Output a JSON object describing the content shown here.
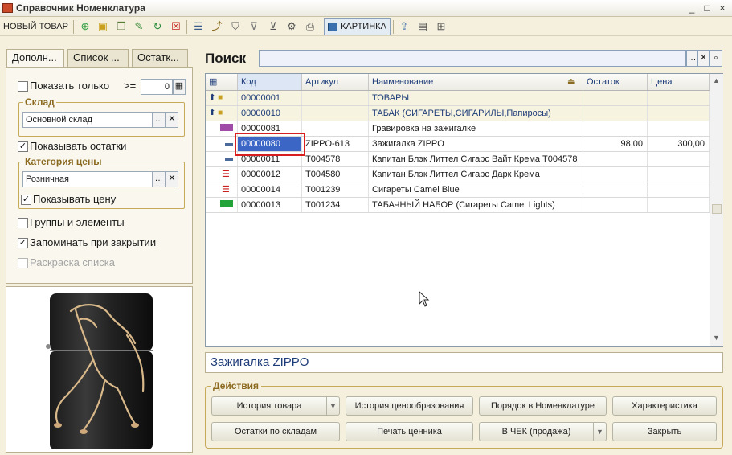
{
  "window": {
    "title": "Справочник Номенклатура",
    "controls": [
      "_",
      "□",
      "×"
    ]
  },
  "toolbar": {
    "new_item": "НОВЫЙ ТОВАР",
    "picture": "КАРТИНКА"
  },
  "left_tabs": [
    "Дополн...",
    "Список ...",
    "Остатк..."
  ],
  "filters": {
    "show_only_label": "Показать только",
    "show_only_op": ">=",
    "show_only_value": "0",
    "warehouse_title": "Склад",
    "warehouse_value": "Основной склад",
    "show_stock_label": "Показывать остатки",
    "price_category_title": "Категория цены",
    "price_category_value": "Розничная",
    "show_price_label": "Показывать цену",
    "groups_label": "Группы и элементы",
    "remember_label": "Запоминать при закрытии",
    "coloring_label": "Раскраска списка"
  },
  "search": {
    "label": "Поиск",
    "value": ""
  },
  "table": {
    "columns": [
      "Код",
      "Артикул",
      "Наименование",
      "Остаток",
      "Цена"
    ],
    "rows": [
      {
        "kind": "group",
        "code": "00000001",
        "article": "",
        "name": "ТОВАРЫ",
        "stock": "",
        "price": ""
      },
      {
        "kind": "group",
        "code": "00000010",
        "article": "",
        "name": "ТАБАК (СИГАРЕТЫ,СИГАРИЛЫ,Папиросы)",
        "stock": "",
        "price": ""
      },
      {
        "kind": "item",
        "code": "00000081",
        "article": "",
        "name": "Гравировка на зажигалке",
        "stock": "",
        "price": ""
      },
      {
        "kind": "item",
        "code": "00000080",
        "article": "ZIPPO-613",
        "name": "Зажигалка ZIPPO",
        "stock": "98,00",
        "price": "300,00"
      },
      {
        "kind": "item",
        "code": "00000011",
        "article": "T004578",
        "name": "Капитан Блэк Литтел Сигарс Вайт Крема T004578",
        "stock": "",
        "price": ""
      },
      {
        "kind": "item",
        "code": "00000012",
        "article": "T004580",
        "name": "Капитан Блэк Литтел Сигарс Дарк Крема",
        "stock": "",
        "price": ""
      },
      {
        "kind": "item",
        "code": "00000014",
        "article": "T001239",
        "name": "Сигареты Camel Blue",
        "stock": "",
        "price": ""
      },
      {
        "kind": "item",
        "code": "00000013",
        "article": "T001234",
        "name": "ТАБАЧНЫЙ НАБОР (Сигареты Camel Lights)",
        "stock": "",
        "price": ""
      }
    ]
  },
  "description": "Зажигалка ZIPPO",
  "actions": {
    "title": "Действия",
    "buttons": [
      "История товара",
      "История ценообразования",
      "Порядок в Номенклатуре",
      "Характеристика",
      "Остатки по складам",
      "Печать ценника",
      "В ЧЕК (продажа)",
      "Закрыть"
    ]
  },
  "colors": {
    "selection": "#3b66c6",
    "highlight_box": "#d81e1e",
    "search_bg": "#eef0fa"
  }
}
